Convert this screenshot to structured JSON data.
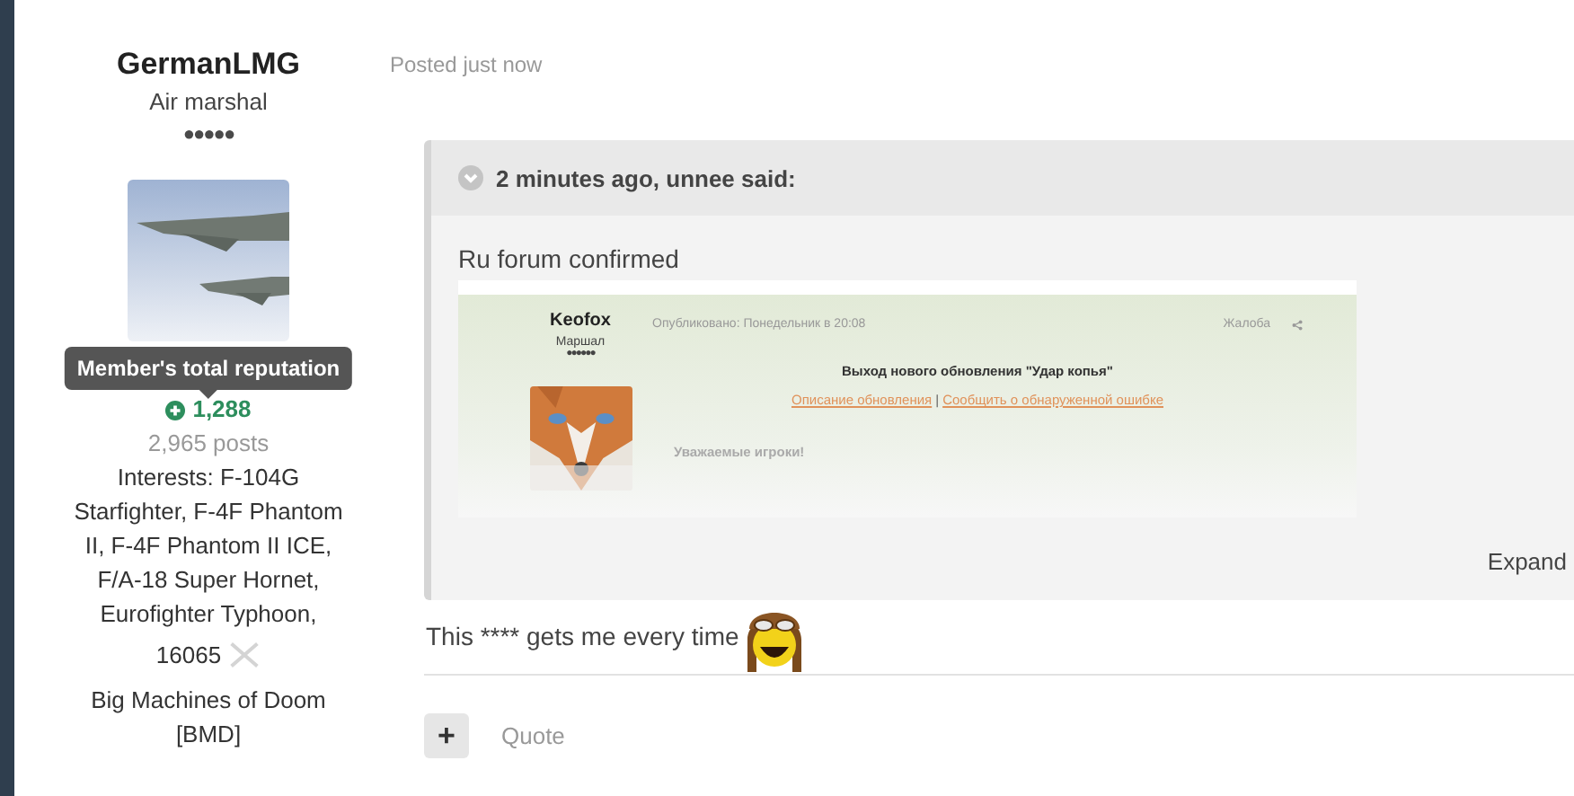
{
  "author": {
    "name": "GermanLMG",
    "rank": "Air marshal",
    "rank_pips": "●●●●●",
    "tooltip": "Member's total reputation",
    "reputation": "1,288",
    "posts": "2,965 posts",
    "interests": "Interests: F-104G Starfighter, F-4F Phantom II, F-4F Phantom II ICE, F/A-18 Super Hornet, Eurofighter Typhoon,",
    "id_number": "16065",
    "squadron": "Big Machines of Doom [BMD]"
  },
  "post": {
    "meta": "Posted just now",
    "quote": {
      "header": "2 minutes ago, unnee said:",
      "text": "Ru forum confirmed",
      "embedded": {
        "author": "Keofox",
        "rank": "Маршал",
        "rank_pips": "●●●●●●",
        "posted": "Опубликовано: Понедельник в 20:08",
        "report": "Жалоба",
        "title": "Выход нового обновления \"Удар копья\"",
        "links": [
          "Описание обновления",
          "Сообщить о обнаруженной ошибке"
        ],
        "separator": "|",
        "greeting": "Уважаемые игроки!"
      },
      "expand": "Expand"
    },
    "body": "This **** gets me every time",
    "actions": {
      "add": "+",
      "quote": "Quote"
    }
  }
}
